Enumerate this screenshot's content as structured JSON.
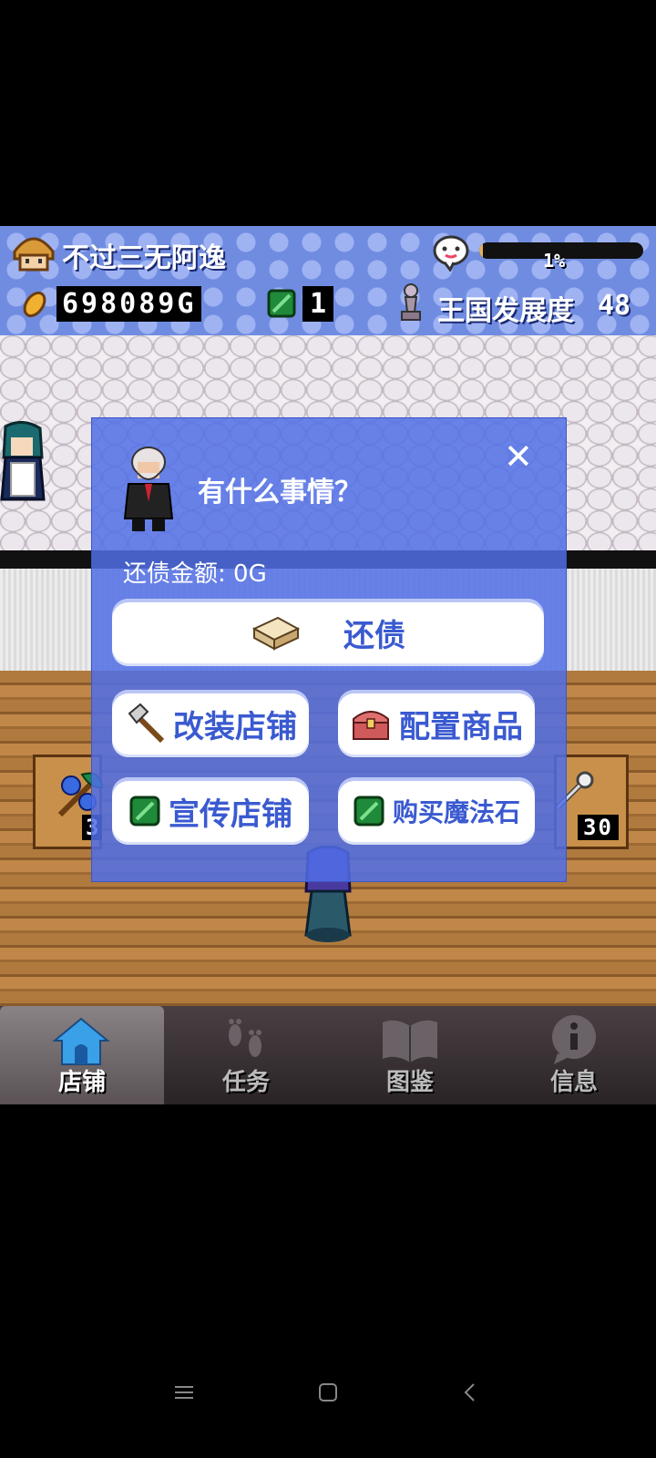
{
  "hud": {
    "player_name": "不过三无阿逸",
    "progress_percent": 1,
    "progress_label": "1%",
    "gold": "698089G",
    "gems": "1",
    "development_label": "王国发展度",
    "development_value": "48"
  },
  "counters": {
    "left_count": "3",
    "right_count": "30"
  },
  "dialog": {
    "title": "有什么事情？",
    "debt_label": "还债金额: 0G",
    "close_label": "✕",
    "repay_label": "还债",
    "remodel_label": "改装店铺",
    "arrange_label": "配置商品",
    "promote_label": "宣传店铺",
    "buy_stone_label": "购买魔法石"
  },
  "tabs": [
    {
      "label": "店铺",
      "icon": "house-icon",
      "active": true
    },
    {
      "label": "任务",
      "icon": "footprints-icon",
      "active": false
    },
    {
      "label": "图鉴",
      "icon": "book-icon",
      "active": false
    },
    {
      "label": "信息",
      "icon": "info-icon",
      "active": false
    }
  ],
  "colors": {
    "hud_blue": "#6f8ce0",
    "dialog_blue": "#506ee6",
    "button_text": "#3a5ad0"
  }
}
